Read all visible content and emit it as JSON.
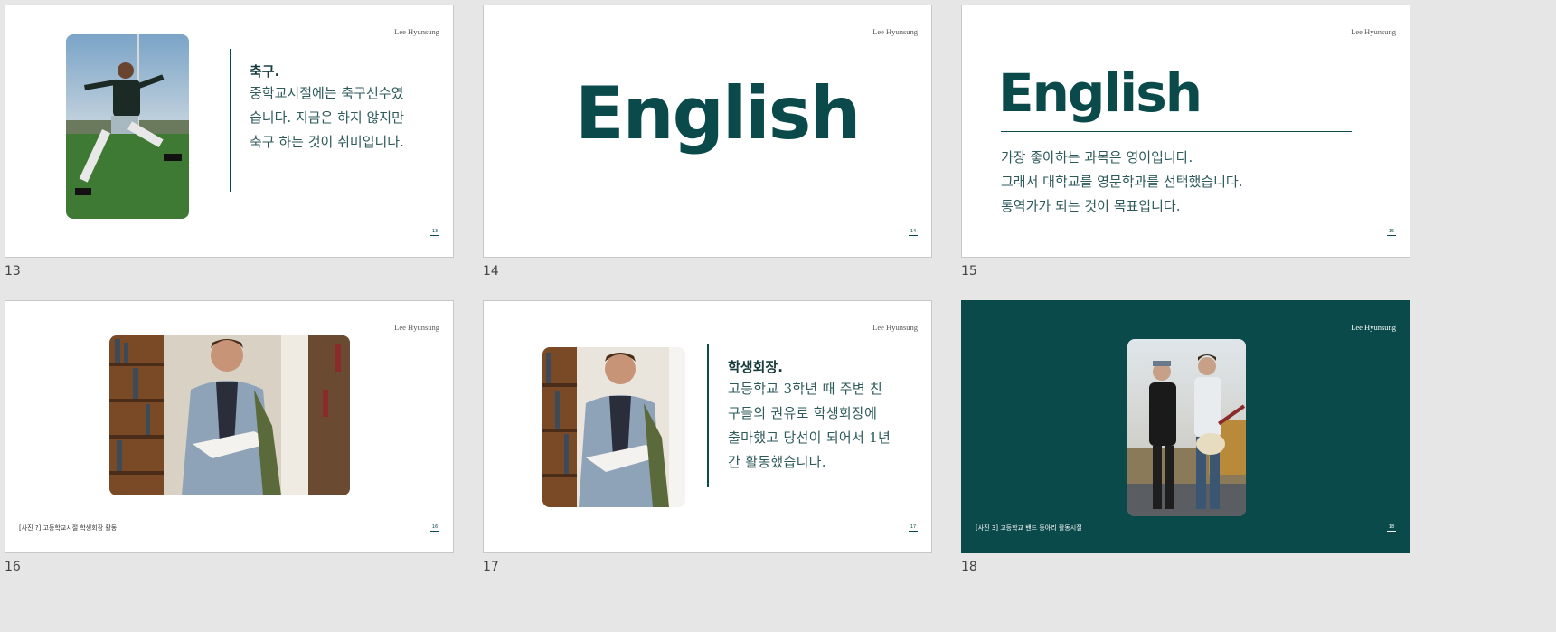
{
  "author": "Lee Hyunsung",
  "slides": [
    {
      "number": "13",
      "page": "13",
      "heading": "축구.",
      "lines": [
        "중학교시절에는 축구선수였",
        "습니다. 지금은 하지 않지만",
        "축구 하는 것이 취미입니다."
      ]
    },
    {
      "number": "14",
      "page": "14",
      "title": "English"
    },
    {
      "number": "15",
      "page": "15",
      "title": "English",
      "lines": [
        "가장 좋아하는 과목은 영어입니다.",
        "그래서 대학교를 영문학과를 선택했습니다.",
        "통역가가 되는 것이 목표입니다."
      ]
    },
    {
      "number": "16",
      "page": "16",
      "caption": "[사진 ?] 고등학교시절 학생회장 활동"
    },
    {
      "number": "17",
      "page": "17",
      "heading": "학생회장.",
      "lines": [
        "고등학교 3학년 때 주변 친",
        "구들의 권유로 학생회장에",
        "출마했고 당선이 되어서 1년",
        "간 활동했습니다."
      ]
    },
    {
      "number": "18",
      "page": "18",
      "caption": "[사진 3] 고등학교 밴드 동아리 활동시절"
    }
  ],
  "colors": {
    "accent": "#0a4a4a",
    "background": "#e6e6e6"
  },
  "icons": [
    "soccer-player-photo",
    "student-reading-photo",
    "band-photo"
  ]
}
